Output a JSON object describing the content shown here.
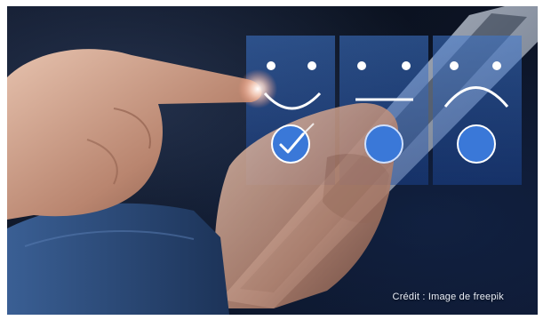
{
  "photo": {
    "credit": "Crédit : Image de freepik"
  },
  "rating_panels": [
    {
      "face": "happy-face-icon",
      "selected": true
    },
    {
      "face": "neutral-face-icon",
      "selected": false
    },
    {
      "face": "sad-face-icon",
      "selected": false
    }
  ],
  "colors": {
    "background": "#0b1220",
    "panel": "#2b5fb0",
    "button_blue": "#3a78d8",
    "face_white": "#ffffff",
    "skin": "#c89a84",
    "sleeve": "#2c4e80"
  }
}
